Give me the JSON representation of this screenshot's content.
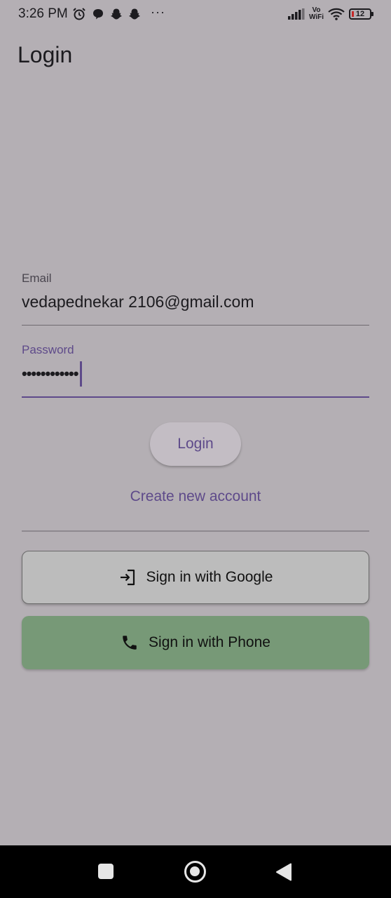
{
  "status_bar": {
    "time": "3:26 PM",
    "more_indicator": "···",
    "network_label_top": "Vo",
    "network_label_bottom": "WiFi",
    "battery_level": "12",
    "icons": [
      "alarm-icon",
      "chat-bubble-icon",
      "snapchat-icon",
      "snapchat-icon",
      "signal-icon",
      "wifi-icon",
      "battery-icon"
    ]
  },
  "app_bar": {
    "title": "Login"
  },
  "form": {
    "email": {
      "label": "Email",
      "value": "vedapednekar 2106@gmail.com"
    },
    "password": {
      "label": "Password",
      "value": "••••••••••••"
    },
    "login_button": "Login",
    "create_account_link": "Create new account"
  },
  "social": {
    "google_button": "Sign in with Google",
    "google_icon": "login-icon",
    "phone_button": "Sign in with Phone",
    "phone_icon": "phone-icon"
  },
  "nav_bar": {
    "icons": [
      "recent-apps-icon",
      "home-icon",
      "back-icon"
    ]
  },
  "colors": {
    "accent": "#5e4a8a",
    "phone_button_bg": "#779977",
    "google_button_bg": "#bcbcbc",
    "background": "#b4afb4"
  }
}
